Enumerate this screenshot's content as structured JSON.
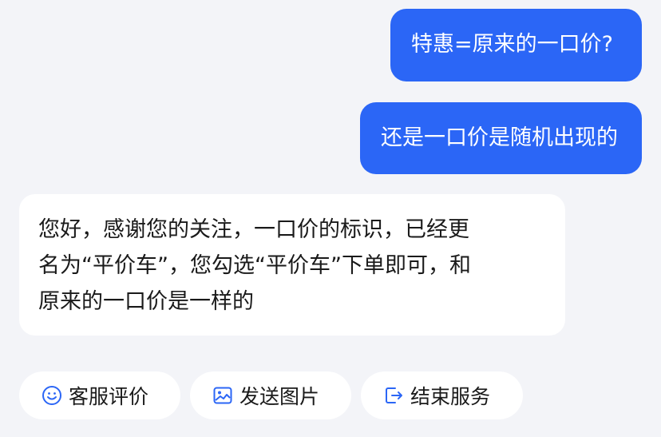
{
  "colors": {
    "background": "#f3f4f8",
    "outgoing_bubble": "#2b66f6",
    "incoming_bubble": "#ffffff",
    "accent_icon": "#2b66f6"
  },
  "messages": {
    "outgoing": [
      {
        "text": "特惠=原来的一口价?"
      },
      {
        "text": "还是一口价是随机出现的"
      }
    ],
    "incoming": {
      "lines": [
        "您好，感谢您的关注，一口价的标识，已经更",
        "名为“平价车”，您勾选“平价车”下单即可，和",
        "原来的一口价是一样的"
      ]
    }
  },
  "quick_actions": [
    {
      "label": "客服评价",
      "icon": "smiley-icon"
    },
    {
      "label": "发送图片",
      "icon": "image-icon"
    },
    {
      "label": "结束服务",
      "icon": "exit-icon"
    }
  ]
}
